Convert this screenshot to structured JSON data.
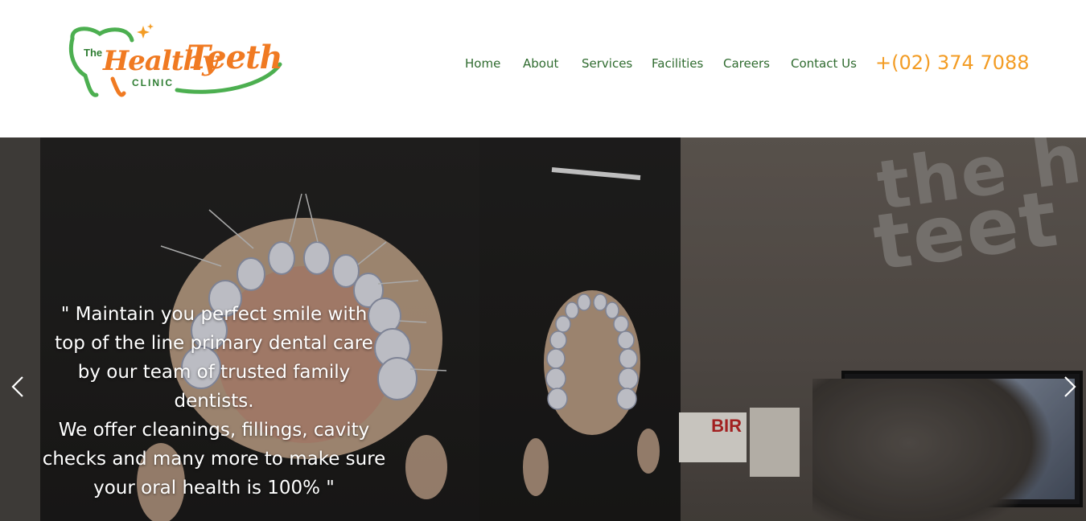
{
  "logo": {
    "the": "The",
    "healthy": "Healthy",
    "teeth": "Teeth",
    "clinic": "CLINIC"
  },
  "nav": {
    "items": [
      {
        "label": "Home"
      },
      {
        "label": "About"
      },
      {
        "label": "Services"
      },
      {
        "label": "Facilities"
      },
      {
        "label": "Careers"
      },
      {
        "label": "Contact Us"
      }
    ],
    "phone": "+(02) 374 7088"
  },
  "hero": {
    "caption_lines": [
      "\" Maintain you perfect smile with",
      "top of the line primary dental care",
      "by our team of trusted family dentists.",
      "We offer cleanings, fillings, cavity",
      "checks and many more to make sure",
      "your oral health is 100% \""
    ],
    "wall_sign_line1": "the h",
    "wall_sign_line2": "teet",
    "bir_sign": "BIR"
  },
  "colors": {
    "brand_green": "#2e7d32",
    "brand_orange": "#f07a22",
    "nav_text": "#2f6b2f",
    "phone": "#f39c24"
  },
  "icons": {
    "prev": "chevron-left-icon",
    "next": "chevron-right-icon"
  }
}
